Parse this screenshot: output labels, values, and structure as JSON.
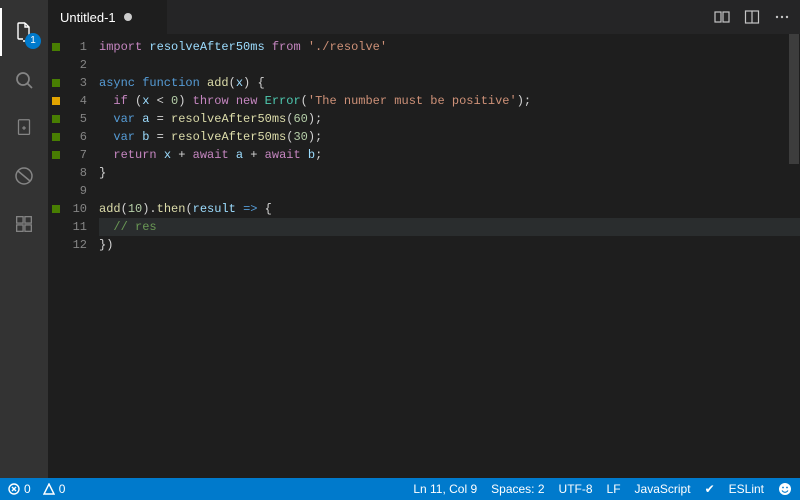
{
  "tab": {
    "title": "Untitled-1"
  },
  "activity": {
    "badge": "1"
  },
  "editor": {
    "lines": [
      {
        "n": 1,
        "mark": "green"
      },
      {
        "n": 2,
        "mark": ""
      },
      {
        "n": 3,
        "mark": "green"
      },
      {
        "n": 4,
        "mark": "yellow"
      },
      {
        "n": 5,
        "mark": "green"
      },
      {
        "n": 6,
        "mark": "green"
      },
      {
        "n": 7,
        "mark": "green"
      },
      {
        "n": 8,
        "mark": ""
      },
      {
        "n": 9,
        "mark": ""
      },
      {
        "n": 10,
        "mark": "green"
      },
      {
        "n": 11,
        "mark": ""
      },
      {
        "n": 12,
        "mark": ""
      }
    ],
    "current_line": 11,
    "tokens": {
      "l1": [
        [
          "tok-key",
          "import "
        ],
        [
          "tok-var",
          "resolveAfter50ms "
        ],
        [
          "tok-key",
          "from "
        ],
        [
          "tok-str",
          "'./resolve'"
        ]
      ],
      "l2": [],
      "l3": [
        [
          "tok-key2",
          "async function "
        ],
        [
          "tok-fn",
          "add"
        ],
        [
          "tok-p",
          "("
        ],
        [
          "tok-var",
          "x"
        ],
        [
          "tok-p",
          ") {"
        ]
      ],
      "l4": [
        [
          "tok-p",
          "  "
        ],
        [
          "tok-key",
          "if "
        ],
        [
          "tok-p",
          "("
        ],
        [
          "tok-var",
          "x"
        ],
        [
          "tok-p",
          " < "
        ],
        [
          "tok-num",
          "0"
        ],
        [
          "tok-p",
          ") "
        ],
        [
          "tok-key",
          "throw new "
        ],
        [
          "tok-cls",
          "Error"
        ],
        [
          "tok-p",
          "("
        ],
        [
          "tok-str",
          "'The number must be positive'"
        ],
        [
          "tok-p",
          ");"
        ]
      ],
      "l5": [
        [
          "tok-p",
          "  "
        ],
        [
          "tok-key2",
          "var "
        ],
        [
          "tok-var",
          "a"
        ],
        [
          "tok-p",
          " = "
        ],
        [
          "tok-fn",
          "resolveAfter50ms"
        ],
        [
          "tok-p",
          "("
        ],
        [
          "tok-num",
          "60"
        ],
        [
          "tok-p",
          ");"
        ]
      ],
      "l6": [
        [
          "tok-p",
          "  "
        ],
        [
          "tok-key2",
          "var "
        ],
        [
          "tok-var",
          "b"
        ],
        [
          "tok-p",
          " = "
        ],
        [
          "tok-fn",
          "resolveAfter50ms"
        ],
        [
          "tok-p",
          "("
        ],
        [
          "tok-num",
          "30"
        ],
        [
          "tok-p",
          ");"
        ]
      ],
      "l7": [
        [
          "tok-p",
          "  "
        ],
        [
          "tok-key",
          "return "
        ],
        [
          "tok-var",
          "x"
        ],
        [
          "tok-p",
          " + "
        ],
        [
          "tok-key",
          "await "
        ],
        [
          "tok-var",
          "a"
        ],
        [
          "tok-p",
          " + "
        ],
        [
          "tok-key",
          "await "
        ],
        [
          "tok-var",
          "b"
        ],
        [
          "tok-p",
          ";"
        ]
      ],
      "l8": [
        [
          "tok-p",
          "}"
        ]
      ],
      "l9": [],
      "l10": [
        [
          "tok-fn",
          "add"
        ],
        [
          "tok-p",
          "("
        ],
        [
          "tok-num",
          "10"
        ],
        [
          "tok-p",
          ")."
        ],
        [
          "tok-fn",
          "then"
        ],
        [
          "tok-p",
          "("
        ],
        [
          "tok-var",
          "result"
        ],
        [
          "tok-p",
          " "
        ],
        [
          "tok-key2",
          "=>"
        ],
        [
          "tok-p",
          " {"
        ]
      ],
      "l11": [
        [
          "tok-p",
          "  "
        ],
        [
          "tok-cmt",
          "// res"
        ]
      ],
      "l12": [
        [
          "tok-p",
          "})"
        ]
      ]
    }
  },
  "status": {
    "errors": "0",
    "warnings": "0",
    "cursor": "Ln 11, Col 9",
    "spaces": "Spaces: 2",
    "encoding": "UTF-8",
    "eol": "LF",
    "language": "JavaScript",
    "check": "✔",
    "eslint": "ESLint"
  }
}
